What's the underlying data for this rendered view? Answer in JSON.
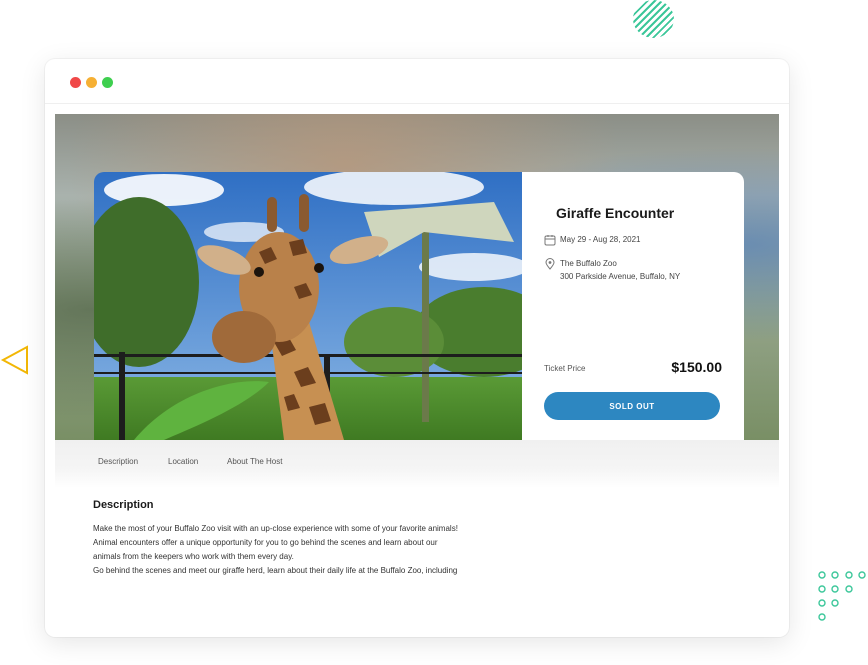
{
  "event": {
    "title": "Giraffe Encounter",
    "date": "May 29 - Aug 28, 2021",
    "venue": "The Buffalo Zoo",
    "address": "300 Parkside Avenue, Buffalo, NY",
    "ticket_label": "Ticket Price",
    "ticket_price": "$150.00",
    "button_label": "SOLD OUT"
  },
  "tabs": [
    "Description",
    "Location",
    "About The Host"
  ],
  "description": {
    "heading": "Description",
    "lines": [
      "Make the most of your Buffalo Zoo visit with an up-close experience with some of your favorite animals!",
      "Animal encounters offer a unique opportunity for you to go behind the scenes and learn about our",
      "animals from the keepers who work with them every day.",
      "Go behind the scenes and meet our giraffe herd, learn about their daily life at the Buffalo Zoo, including"
    ]
  },
  "colors": {
    "accent": "#2d87c1",
    "decoration": "#3cc79a",
    "triangle": "#f2b705"
  },
  "icons": [
    "calendar-icon",
    "location-pin-icon"
  ]
}
